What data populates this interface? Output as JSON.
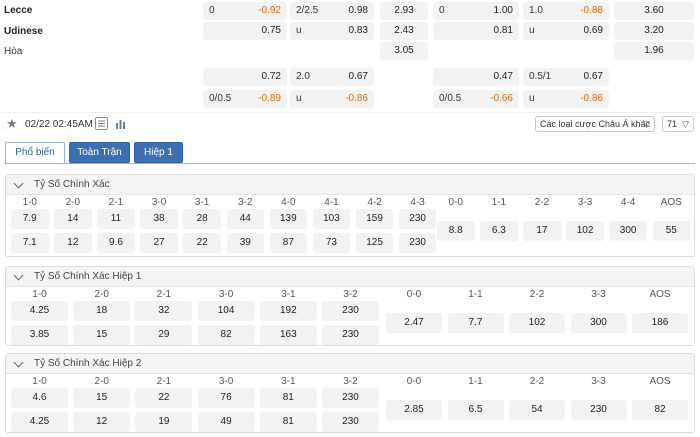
{
  "teams": {
    "home": "Lecce",
    "away": "Udinese",
    "draw": "Hòa"
  },
  "odds": {
    "row1": {
      "ah_line": "0",
      "ah_val": "-0.92",
      "ou_line": "2/2.5",
      "ou_val": "0.98",
      "x12": "2.93",
      "h1_ah_line": "0",
      "h1_ah_val": "1.00",
      "h1_ou_line": "1.0",
      "h1_ou_val": "-0.88",
      "h1_x12": "3.60"
    },
    "row2": {
      "ah_val": "0.75",
      "ou_line": "u",
      "ou_val": "0.83",
      "x12": "2.43",
      "h1_ah_val": "0.81",
      "h1_ou_line": "u",
      "h1_ou_val": "0.69",
      "h1_x12": "3.20"
    },
    "row3": {
      "x12": "3.05",
      "h1_x12": "1.96"
    },
    "row4": {
      "ah_val": "0.72",
      "ou_line": "2.0",
      "ou_val": "0.67",
      "h1_ah_val": "0.47",
      "h1_ou_line": "0.5/1",
      "h1_ou_val": "0.67"
    },
    "row5": {
      "ah_line": "0/0.5",
      "ah_val": "-0.89",
      "ou_line": "u",
      "ou_val": "-0.86",
      "h1_ah_line": "0/0.5",
      "h1_ah_val": "-0.66",
      "h1_ou_line": "u",
      "h1_ou_val": "-0.86"
    }
  },
  "toolbar": {
    "datetime": "02/22 02:45AM",
    "odds_type_select": "Các loại cược Châu Á khác",
    "count": "71"
  },
  "tabs": [
    "Phổ biến",
    "Toàn Trận",
    "Hiệp 1"
  ],
  "sections": [
    {
      "title": "Tỷ Số Chính Xác",
      "headers": [
        "1-0",
        "2-0",
        "2-1",
        "3-0",
        "3-1",
        "3-2",
        "4-0",
        "4-1",
        "4-2",
        "4-3",
        "0-0",
        "1-1",
        "2-2",
        "3-3",
        "4-4",
        "AOS"
      ],
      "home": [
        "7.9",
        "14",
        "11",
        "38",
        "28",
        "44",
        "139",
        "103",
        "159",
        "230"
      ],
      "away": [
        "7.1",
        "12",
        "9.6",
        "27",
        "22",
        "39",
        "87",
        "73",
        "125",
        "230"
      ],
      "draws": [
        "8.8",
        "6.3",
        "17",
        "102",
        "300",
        "55"
      ]
    },
    {
      "title": "Tỷ Số Chính Xác Hiệp 1",
      "headers": [
        "1-0",
        "2-0",
        "2-1",
        "3-0",
        "3-1",
        "3-2",
        "0-0",
        "1-1",
        "2-2",
        "3-3",
        "AOS"
      ],
      "home": [
        "4.25",
        "18",
        "32",
        "104",
        "192",
        "230"
      ],
      "away": [
        "3.85",
        "15",
        "29",
        "82",
        "163",
        "230"
      ],
      "draws": [
        "2.47",
        "7.7",
        "102",
        "300",
        "186"
      ]
    },
    {
      "title": "Tỷ Số Chính Xác Hiệp 2",
      "headers": [
        "1-0",
        "2-0",
        "2-1",
        "3-0",
        "3-1",
        "3-2",
        "0-0",
        "1-1",
        "2-2",
        "3-3",
        "AOS"
      ],
      "home": [
        "4.6",
        "15",
        "22",
        "76",
        "81",
        "230"
      ],
      "away": [
        "4.25",
        "12",
        "19",
        "49",
        "81",
        "230"
      ],
      "draws": [
        "2.85",
        "6.5",
        "54",
        "230",
        "82"
      ]
    }
  ],
  "icons": {
    "star": "star-icon",
    "list": "list-icon",
    "chart": "bar-chart-icon"
  },
  "colors": {
    "negative": "#e06a12",
    "tab_button": "#3f6fb3",
    "cell_bg": "#f2f2f2"
  }
}
